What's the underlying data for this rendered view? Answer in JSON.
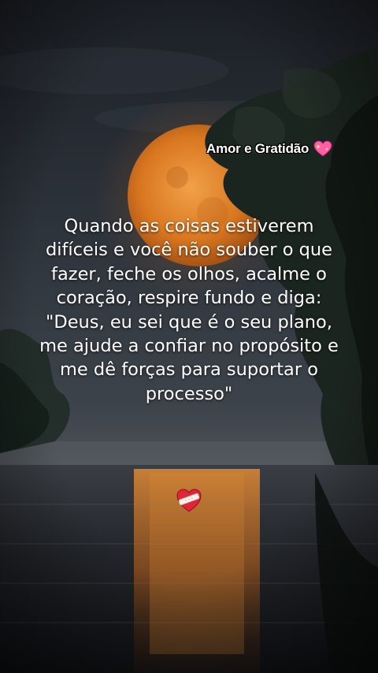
{
  "brand": {
    "label": "Amor e Gratidão",
    "icon": "sparkling-heart-icon",
    "icon_color": "#ff5fa8"
  },
  "quote": {
    "text": "Quando as coisas estiverem difíceis e você não souber o que fazer, feche os olhos, acalme o coração, respire fundo e diga: \"Deus, eu sei que é o seu plano, me ajude a confiar no propósito e me dê forças para suportar o processo\""
  },
  "footer_icon": {
    "icon": "mending-heart-icon",
    "color": "#e0253a"
  },
  "colors": {
    "sky_top": "#2a2f36",
    "moon": "#e0822a",
    "water_glow": "#c96a1e"
  }
}
